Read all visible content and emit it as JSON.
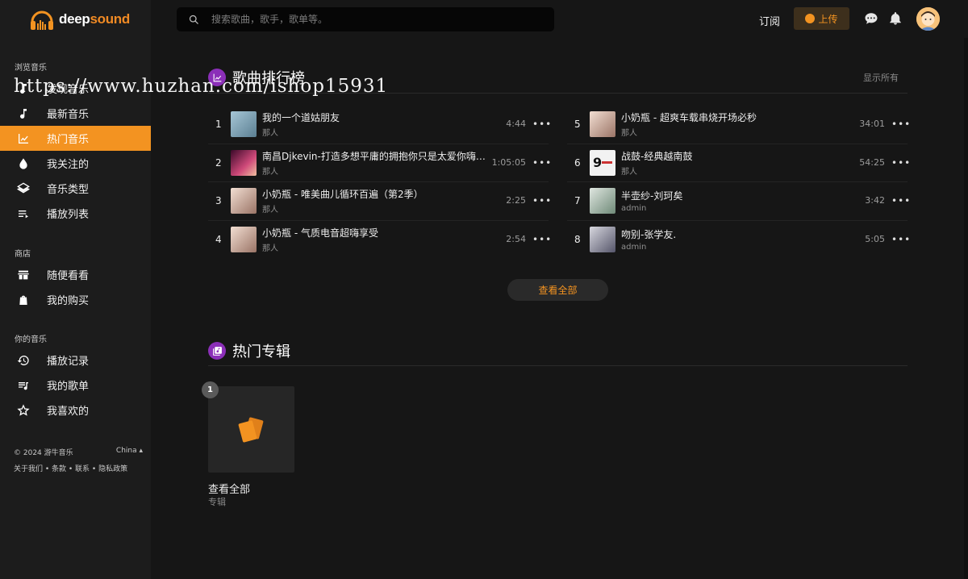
{
  "brand": {
    "name_part1": "deep",
    "name_part2": "sound",
    "accent": "#f39321"
  },
  "watermark": "https://www.huzhan.com/ishop15931",
  "sidebar": {
    "sections": [
      {
        "title": "浏览音乐"
      },
      {
        "title": "商店"
      },
      {
        "title": "你的音乐"
      }
    ],
    "browse": [
      {
        "label": "发现音乐",
        "icon": "music-note-icon"
      },
      {
        "label": "最新音乐",
        "icon": "music-note-icon"
      },
      {
        "label": "热门音乐",
        "icon": "trending-chart-icon",
        "active": true
      },
      {
        "label": "我关注的",
        "icon": "drop-icon"
      },
      {
        "label": "音乐类型",
        "icon": "layers-icon"
      },
      {
        "label": "播放列表",
        "icon": "playlist-icon"
      }
    ],
    "store": [
      {
        "label": "随便看看",
        "icon": "store-icon"
      },
      {
        "label": "我的购买",
        "icon": "shopping-bag-icon"
      }
    ],
    "mine": [
      {
        "label": "播放记录",
        "icon": "history-icon"
      },
      {
        "label": "我的歌单",
        "icon": "queue-music-icon"
      },
      {
        "label": "我喜欢的",
        "icon": "star-icon"
      }
    ],
    "footer": {
      "copyright": "© 2024 游牛音乐",
      "region": "China ▴",
      "links": "关于我们 • 条款 • 联系 • 隐私政策"
    }
  },
  "header": {
    "search_placeholder": "搜索歌曲，歌手，歌单等。",
    "subscribe": "订阅",
    "upload": "上传"
  },
  "charts_section": {
    "title": "歌曲排行榜",
    "show_all": "显示所有",
    "view_all_button": "查看全部",
    "tracks": [
      {
        "rank": "1",
        "title": "我的一个道姑朋友",
        "artist": "那人",
        "duration": "4:44",
        "cover": "#7fa3b5"
      },
      {
        "rank": "2",
        "title": "南昌Djkevin-打造多想平庸的拥抱你只是太爱你嗨串...",
        "artist": "那人",
        "duration": "1:05:05",
        "cover": "#b23060"
      },
      {
        "rank": "3",
        "title": "小奶瓶 - 唯美曲儿循环百遍（第2季）",
        "artist": "那人",
        "duration": "2:25",
        "cover": "#c8a79a"
      },
      {
        "rank": "4",
        "title": "小奶瓶 - 气质电音超嗨享受",
        "artist": "那人",
        "duration": "2:54",
        "cover": "#c8a79a"
      },
      {
        "rank": "5",
        "title": "小奶瓶 - 超爽车载串烧开场必秒",
        "artist": "那人",
        "duration": "34:01",
        "cover": "#c8a79a"
      },
      {
        "rank": "6",
        "title": "战鼓-经典越南鼓",
        "artist": "那人",
        "duration": "54:25",
        "cover": "#e9e9e9"
      },
      {
        "rank": "7",
        "title": "半壶纱-刘珂矣",
        "artist": "admin",
        "duration": "3:42",
        "cover": "#9fb2a4"
      },
      {
        "rank": "8",
        "title": "吻别-张学友.",
        "artist": "admin",
        "duration": "5:05",
        "cover": "#a4a4ae"
      }
    ]
  },
  "albums_section": {
    "title": "热门专辑",
    "albums": [
      {
        "badge": "1",
        "title": "查看全部",
        "subtitle": "专辑"
      }
    ]
  }
}
